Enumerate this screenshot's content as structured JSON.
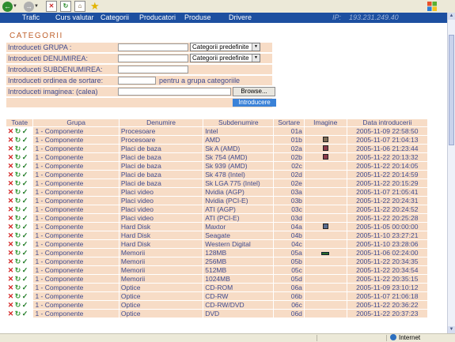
{
  "browser": {
    "zone_text": "Internet",
    "colors": {
      "back": "#2f8d2f",
      "forward": "#9a9a9a",
      "stop": "#cc2a2a",
      "refresh": "#2f8d2f"
    }
  },
  "nav": {
    "items": [
      "Trafic",
      "Curs valutar",
      "Categorii",
      "Producatori",
      "Produse",
      "Drivere"
    ],
    "ip_label": "IP:",
    "ip_value": "193.231.249.40"
  },
  "page_title": "CATEGORII",
  "form": {
    "grupa_label": "Introduceti GRUPA :",
    "grupa_value": "",
    "grupa_select": "Categorii predefinite",
    "denumire_label": "Introduceti DENUMIREA:",
    "denumire_value": "",
    "denumire_select": "Categorii predefinite",
    "subdenumire_label": "Introduceti SUBDENUMIREA:",
    "subdenumire_value": "",
    "ordine_label": "Introduceti ordinea de sortare:",
    "ordine_value": "",
    "ordine_hint": "pentru a grupa categoriile",
    "imagine_label": "Introduceti imaginea: (calea)",
    "imagine_value": "",
    "browse_label": "Browse...",
    "submit_label": "Introducere"
  },
  "table": {
    "headers": [
      "Toate",
      "Grupa",
      "Denumire",
      "Subdenumire",
      "Sortare",
      "Imagine",
      "Data introducerii"
    ],
    "row_icons": [
      "delete-icon",
      "edit-icon",
      "check-icon"
    ],
    "rows": [
      {
        "grupa": "1 - Componente",
        "denumire": "Procesoare",
        "subdenumire": "Intel",
        "sortare": "01a",
        "imagine": "",
        "data": "2005-11-09 22:58:50"
      },
      {
        "grupa": "1 - Componente",
        "denumire": "Procesoare",
        "subdenumire": "AMD",
        "sortare": "01b",
        "imagine": "cpu",
        "data": "2005-11-07 21:04:13"
      },
      {
        "grupa": "1 - Componente",
        "denumire": "Placi de baza",
        "subdenumire": "Sk A (AMD)",
        "sortare": "02a",
        "imagine": "mb",
        "data": "2005-11-06 21:23:44"
      },
      {
        "grupa": "1 - Componente",
        "denumire": "Placi de baza",
        "subdenumire": "Sk 754 (AMD)",
        "sortare": "02b",
        "imagine": "mb",
        "data": "2005-11-22 20:13:32"
      },
      {
        "grupa": "1 - Componente",
        "denumire": "Placi de baza",
        "subdenumire": "Sk 939 (AMD)",
        "sortare": "02c",
        "imagine": "",
        "data": "2005-11-22 20:14:05"
      },
      {
        "grupa": "1 - Componente",
        "denumire": "Placi de baza",
        "subdenumire": "Sk 478 (Intel)",
        "sortare": "02d",
        "imagine": "",
        "data": "2005-11-22 20:14:59"
      },
      {
        "grupa": "1 - Componente",
        "denumire": "Placi de baza",
        "subdenumire": "Sk LGA 775 (Intel)",
        "sortare": "02e",
        "imagine": "",
        "data": "2005-11-22 20:15:29"
      },
      {
        "grupa": "1 - Componente",
        "denumire": "Placi video",
        "subdenumire": "Nvidia (AGP)",
        "sortare": "03a",
        "imagine": "",
        "data": "2005-11-07 21:05:41"
      },
      {
        "grupa": "1 - Componente",
        "denumire": "Placi video",
        "subdenumire": "Nvidia (PCI-E)",
        "sortare": "03b",
        "imagine": "",
        "data": "2005-11-22 20:24:31"
      },
      {
        "grupa": "1 - Componente",
        "denumire": "Placi video",
        "subdenumire": "ATI (AGP)",
        "sortare": "03c",
        "imagine": "",
        "data": "2005-11-22 20:24:52"
      },
      {
        "grupa": "1 - Componente",
        "denumire": "Placi video",
        "subdenumire": "ATI (PCI-E)",
        "sortare": "03d",
        "imagine": "",
        "data": "2005-11-22 20:25:28"
      },
      {
        "grupa": "1 - Componente",
        "denumire": "Hard Disk",
        "subdenumire": "Maxtor",
        "sortare": "04a",
        "imagine": "hd",
        "data": "2005-11-05 00:00:00"
      },
      {
        "grupa": "1 - Componente",
        "denumire": "Hard Disk",
        "subdenumire": "Seagate",
        "sortare": "04b",
        "imagine": "",
        "data": "2005-11-10 23:27:21"
      },
      {
        "grupa": "1 - Componente",
        "denumire": "Hard Disk",
        "subdenumire": "Western Digital",
        "sortare": "04c",
        "imagine": "",
        "data": "2005-11-10 23:28:06"
      },
      {
        "grupa": "1 - Componente",
        "denumire": "Memorii",
        "subdenumire": "128MB",
        "sortare": "05a",
        "imagine": "mem",
        "data": "2005-11-06 02:24:00"
      },
      {
        "grupa": "1 - Componente",
        "denumire": "Memorii",
        "subdenumire": "256MB",
        "sortare": "05b",
        "imagine": "",
        "data": "2005-11-22 20:34:35"
      },
      {
        "grupa": "1 - Componente",
        "denumire": "Memorii",
        "subdenumire": "512MB",
        "sortare": "05c",
        "imagine": "",
        "data": "2005-11-22 20:34:54"
      },
      {
        "grupa": "1 - Componente",
        "denumire": "Memorii",
        "subdenumire": "1024MB",
        "sortare": "05d",
        "imagine": "",
        "data": "2005-11-22 20:35:15"
      },
      {
        "grupa": "1 - Componente",
        "denumire": "Optice",
        "subdenumire": "CD-ROM",
        "sortare": "06a",
        "imagine": "",
        "data": "2005-11-09 23:10:12"
      },
      {
        "grupa": "1 - Componente",
        "denumire": "Optice",
        "subdenumire": "CD-RW",
        "sortare": "06b",
        "imagine": "",
        "data": "2005-11-07 21:06:18"
      },
      {
        "grupa": "1 - Componente",
        "denumire": "Optice",
        "subdenumire": "CD-RW/DVD",
        "sortare": "06c",
        "imagine": "",
        "data": "2005-11-22 20:36:22"
      },
      {
        "grupa": "1 - Componente",
        "denumire": "Optice",
        "subdenumire": "DVD",
        "sortare": "06d",
        "imagine": "",
        "data": "2005-11-22 20:37:23"
      }
    ]
  }
}
